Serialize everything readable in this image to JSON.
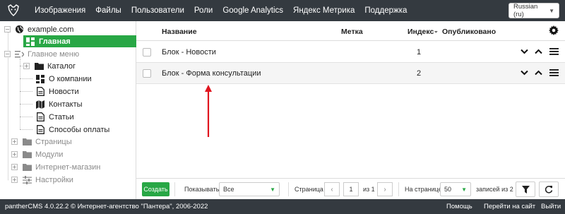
{
  "topbar": {
    "logo": "panther-logo-icon",
    "nav": [
      "Изображения",
      "Файлы",
      "Пользователи",
      "Роли",
      "Google Analytics",
      "Яндекс Метрика",
      "Поддержка"
    ],
    "language": "Russian (ru)"
  },
  "sidebar": {
    "site": "example.com",
    "items": [
      {
        "label": "Главная",
        "icon": "dashboard-icon",
        "active": true
      },
      {
        "label": "Главное меню",
        "icon": "menu-icon"
      },
      {
        "label": "Каталог",
        "icon": "folder-icon"
      },
      {
        "label": "О компании",
        "icon": "dashboard-icon"
      },
      {
        "label": "Новости",
        "icon": "file-icon"
      },
      {
        "label": "Контакты",
        "icon": "map-icon"
      },
      {
        "label": "Статьи",
        "icon": "file-icon"
      },
      {
        "label": "Способы оплаты",
        "icon": "file-icon"
      },
      {
        "label": "Страницы",
        "icon": "folder-icon"
      },
      {
        "label": "Модули",
        "icon": "folder-icon"
      },
      {
        "label": "Интернет-магазин",
        "icon": "folder-icon"
      },
      {
        "label": "Настройки",
        "icon": "sliders-icon"
      }
    ]
  },
  "table": {
    "columns": {
      "name": "Название",
      "tag": "Метка",
      "index": "Индекс",
      "published": "Опубликовано"
    },
    "rows": [
      {
        "name": "Блок - Новости",
        "index": "1"
      },
      {
        "name": "Блок - Форма консультации",
        "index": "2"
      }
    ]
  },
  "toolbar": {
    "create": "Создать",
    "show_label": "Показывать",
    "show_value": "Все",
    "page_label": "Страница",
    "page_value": "1",
    "page_of": "из 1",
    "per_page_label": "На странице",
    "per_page_value": "50",
    "records": "записей из 2"
  },
  "footer": {
    "copyright": "pantherCMS 4.0.22.2 © Интернет-агентство \"Пантера\", 2006-2022",
    "help": "Помощь",
    "goto_site": "Перейти на сайт",
    "logout": "Выйти"
  },
  "colors": {
    "accent": "#28a745",
    "dark": "#343a40",
    "arrow": "#e0141e"
  }
}
